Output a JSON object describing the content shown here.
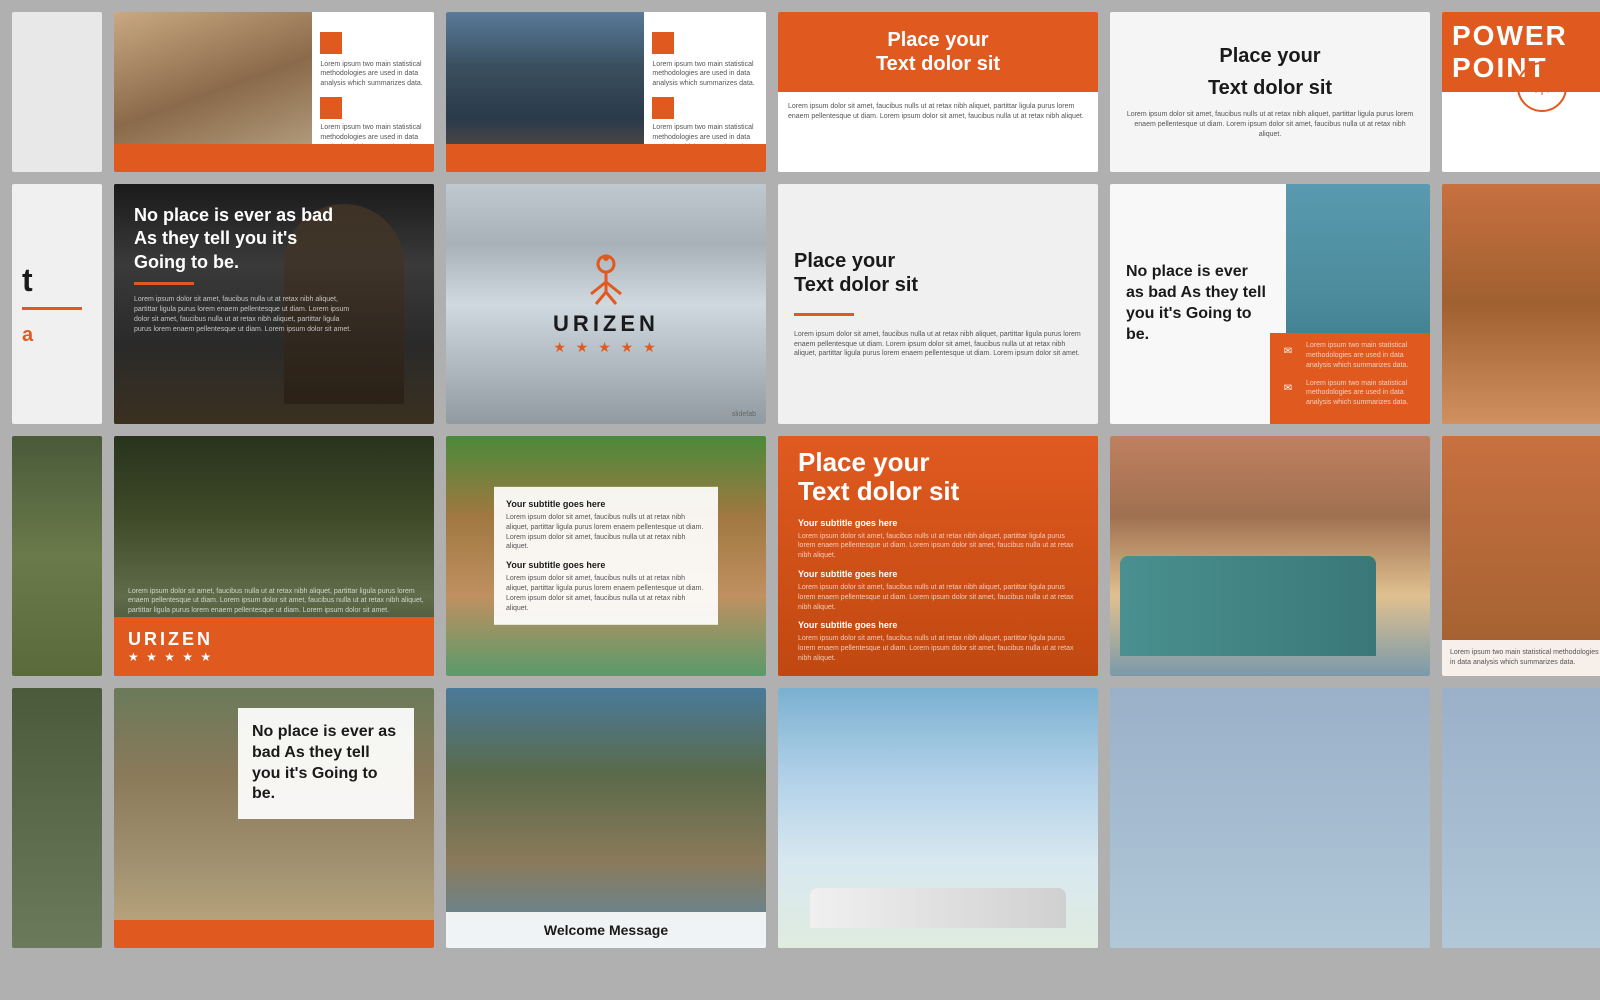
{
  "slides": {
    "quote_main": "No place is ever as bad As they tell you it's Going to be.",
    "quote_short": "No place is ever as bad As they tell you it's Going to be.",
    "place_your_text": "Place your",
    "text_dolor_sit": "Text dolor sit",
    "power_point": "POWER POINT",
    "brand_name": "URIZEN",
    "stars": "★ ★ ★ ★ ★",
    "subtitle_goes_here": "Your subtitle goes here",
    "welcome_message": "Welcome Message",
    "lorem_short": "Lorem ipsum dolor sit amet, faucibus nulls ut at retax nibh aliquet, partittar ligula purus lorem enaem pellentesque ut diam. Lorem ipsum dolor sit amet, faucibus nulla ut at retax nibh aliquet.",
    "lorem_tiny": "Lorem ipsum two main statistical methodologies are used in data analysis which summarizes data.",
    "lorem_body": "Lorem ipsum dolor sit amet, faucibus nulla ut at retax nibh aliquet, partittar ligula purus lorem enaem pellentesque ut diam. Lorem ipsum dolor sit amet, faucibus nulla ut at retax nibh aliquet, partittar ligula purus lorem enaem pellentesque ut diam. Lorem ipsum dolor sit amet."
  }
}
